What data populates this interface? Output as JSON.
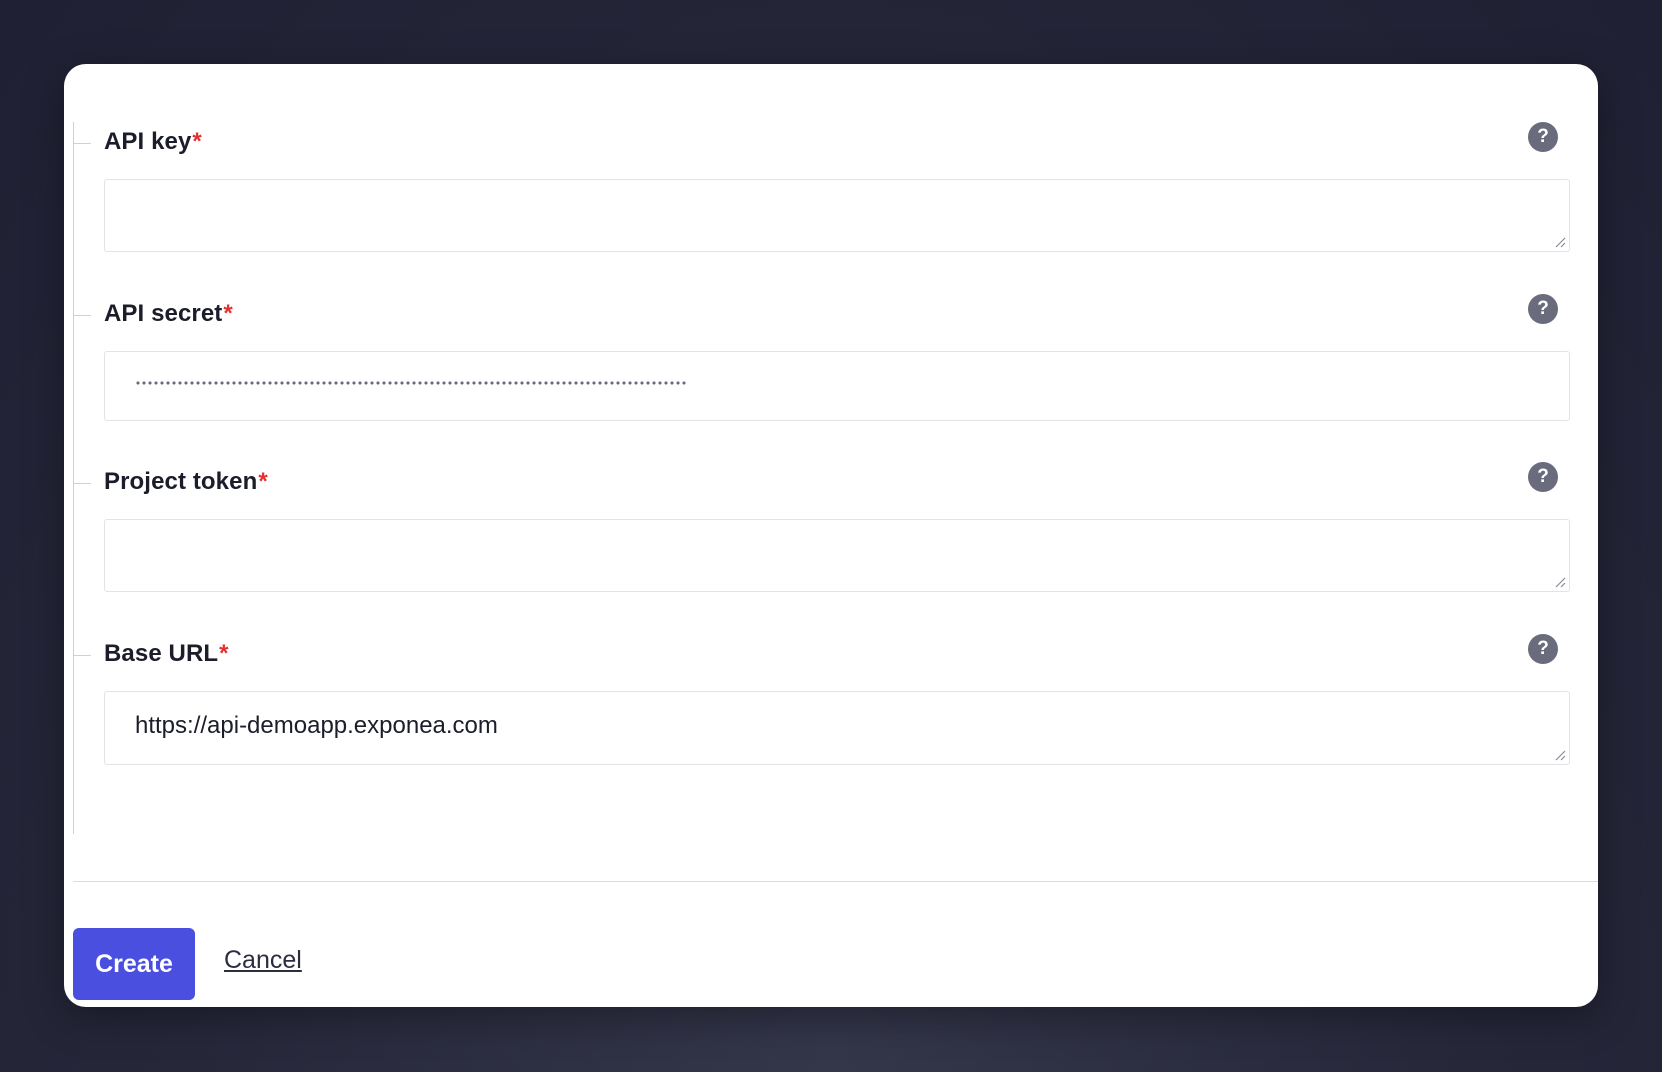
{
  "form": {
    "fields": [
      {
        "label": "API key",
        "required_mark": "*",
        "value": "",
        "type": "textarea"
      },
      {
        "label": "API secret",
        "required_mark": "*",
        "value": "",
        "type": "password"
      },
      {
        "label": "Project token",
        "required_mark": "*",
        "value": "",
        "type": "textarea"
      },
      {
        "label": "Base URL",
        "required_mark": "*",
        "value": "https://api-demoapp.exponea.com",
        "type": "textarea"
      }
    ],
    "help_glyph": "?"
  },
  "footer": {
    "create_label": "Create",
    "cancel_label": "Cancel"
  },
  "colors": {
    "primary_button": "#4a4fe0",
    "required_asterisk": "#e3312f",
    "help_icon_bg": "#6a6b7d",
    "backdrop": "#262739"
  }
}
